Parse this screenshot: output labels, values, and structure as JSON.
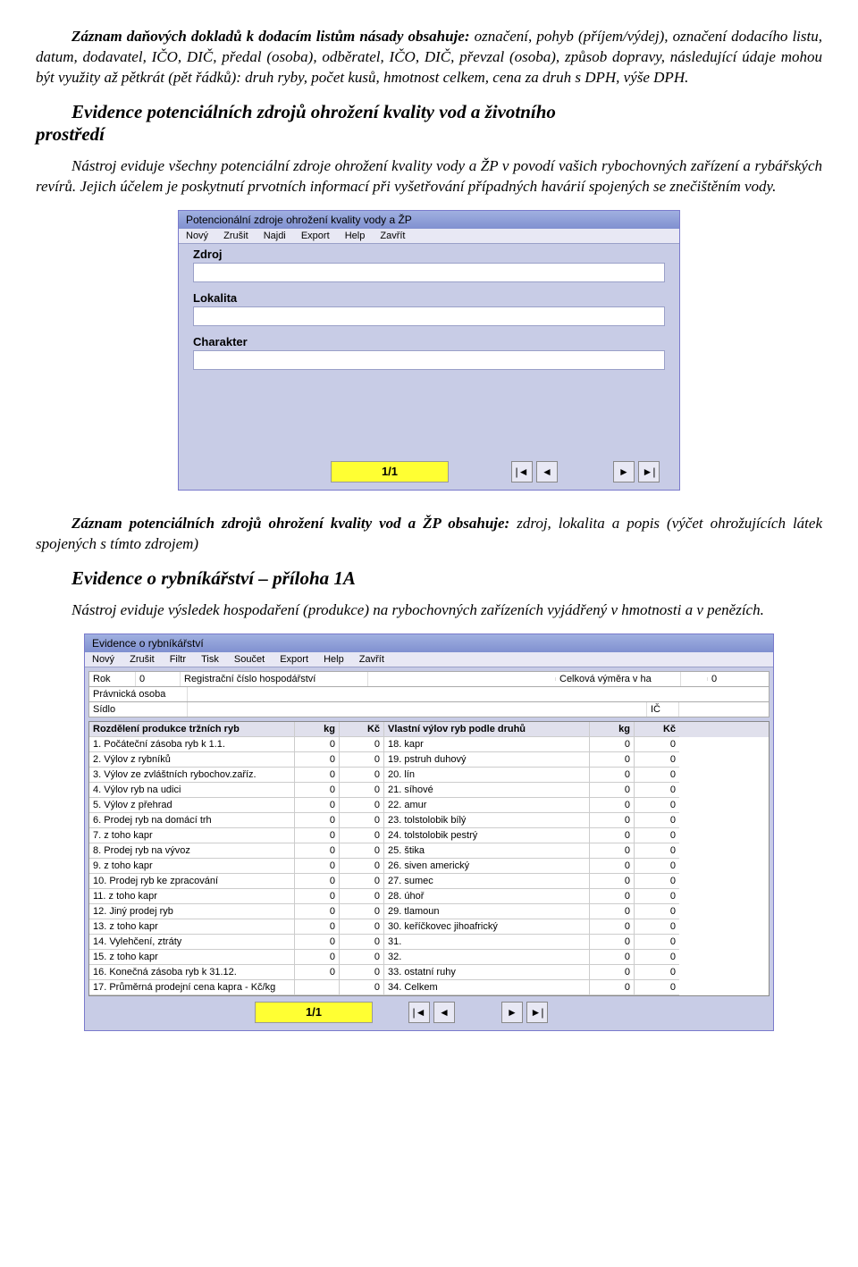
{
  "para1_lead": "Záznam daňových dokladů k dodacím listům násady obsahuje:",
  "para1_rest": " označení, pohyb (příjem/výdej), označení dodacího listu, datum, dodavatel, IČO, DIČ, předal (osoba), odběratel, IČO, DIČ, převzal (osoba), způsob dopravy, následující údaje mohou být využity až pětkrát (pět řádků): druh ryby, počet kusů, hmotnost celkem, cena za druh s DPH, výše DPH.",
  "heading1_head": "Evidence potenciálních zdrojů ohrožení kvality vod a životního",
  "heading1_tail": "prostředí",
  "para2": "Nástroj eviduje všechny potenciální zdroje ohrožení kvality vody a ŽP v povodí vašich rybochovných zařízení a rybářských revírů. Jejich účelem je poskytnutí prvotních informací při vyšetřování případných havárií spojených se znečištěním vody.",
  "win1": {
    "title": "Potencionální zdroje ohrožení kvality vody a ŽP",
    "menu": [
      "Nový",
      "Zrušit",
      "Najdi",
      "Export",
      "Help",
      "Zavřít"
    ],
    "labels": {
      "zdroj": "Zdroj",
      "lokalita": "Lokalita",
      "charakter": "Charakter"
    },
    "pager": "1/1"
  },
  "para3_lead": "Záznam potenciálních zdrojů ohrožení kvality vod a ŽP obsahuje:",
  "para3_rest": " zdroj, lokalita a popis (výčet ohrožujících látek spojených s tímto zdrojem)",
  "heading2": "Evidence o rybníkářství – příloha 1A",
  "para4": "Nástroj eviduje výsledek hospodaření (produkce) na rybochovných zařízeních vyjádřený v hmotnosti a v penězích.",
  "win2": {
    "title": "Evidence o rybníkářství",
    "menu": [
      "Nový",
      "Zrušit",
      "Filtr",
      "Tisk",
      "Součet",
      "Export",
      "Help",
      "Zavřít"
    ],
    "top": {
      "rok_lbl": "Rok",
      "rok_val": "0",
      "reg_lbl": "Registrační číslo hospodářství",
      "vymera_lbl": "Celková výměra v ha",
      "vymera_val": "0",
      "prav_lbl": "Právnická osoba",
      "sidlo_lbl": "Sídlo",
      "ic_lbl": "IČ"
    },
    "head": {
      "left": "Rozdělení produkce tržních ryb",
      "kg": "kg",
      "kc": "Kč",
      "right": "Vlastní výlov ryb podle druhů",
      "kg2": "kg",
      "kc2": "Kč"
    },
    "rows": [
      {
        "l": "1. Počáteční zásoba ryb k 1.1.",
        "lkg": "0",
        "lkc": "0",
        "r": "18. kapr",
        "rkg": "0",
        "rkc": "0"
      },
      {
        "l": "2. Výlov z rybníků",
        "lkg": "0",
        "lkc": "0",
        "r": "19. pstruh duhový",
        "rkg": "0",
        "rkc": "0"
      },
      {
        "l": "3. Výlov ze zvláštních rybochov.zaříz.",
        "lkg": "0",
        "lkc": "0",
        "r": "20. lín",
        "rkg": "0",
        "rkc": "0"
      },
      {
        "l": "4. Výlov ryb na udici",
        "lkg": "0",
        "lkc": "0",
        "r": "21. síhové",
        "rkg": "0",
        "rkc": "0"
      },
      {
        "l": "5. Výlov z přehrad",
        "lkg": "0",
        "lkc": "0",
        "r": "22. amur",
        "rkg": "0",
        "rkc": "0"
      },
      {
        "l": "6. Prodej ryb na domácí trh",
        "lkg": "0",
        "lkc": "0",
        "r": "23. tolstolobik bílý",
        "rkg": "0",
        "rkc": "0"
      },
      {
        "l": "7. z toho kapr",
        "lkg": "0",
        "lkc": "0",
        "r": "24. tolstolobik pestrý",
        "rkg": "0",
        "rkc": "0"
      },
      {
        "l": "8. Prodej ryb na vývoz",
        "lkg": "0",
        "lkc": "0",
        "r": "25. štika",
        "rkg": "0",
        "rkc": "0"
      },
      {
        "l": "9. z toho kapr",
        "lkg": "0",
        "lkc": "0",
        "r": "26. siven americký",
        "rkg": "0",
        "rkc": "0"
      },
      {
        "l": "10. Prodej ryb ke zpracování",
        "lkg": "0",
        "lkc": "0",
        "r": "27. sumec",
        "rkg": "0",
        "rkc": "0"
      },
      {
        "l": "11. z toho kapr",
        "lkg": "0",
        "lkc": "0",
        "r": "28. úhoř",
        "rkg": "0",
        "rkc": "0"
      },
      {
        "l": "12. Jiný prodej ryb",
        "lkg": "0",
        "lkc": "0",
        "r": "29. tlamoun",
        "rkg": "0",
        "rkc": "0"
      },
      {
        "l": "13. z toho kapr",
        "lkg": "0",
        "lkc": "0",
        "r": "30. keříčkovec jihoafrický",
        "rkg": "0",
        "rkc": "0"
      },
      {
        "l": "14. Vylehčení, ztráty",
        "lkg": "0",
        "lkc": "0",
        "r": "31.",
        "rkg": "0",
        "rkc": "0"
      },
      {
        "l": "15. z toho kapr",
        "lkg": "0",
        "lkc": "0",
        "r": "32.",
        "rkg": "0",
        "rkc": "0"
      },
      {
        "l": "16. Konečná zásoba ryb k 31.12.",
        "lkg": "0",
        "lkc": "0",
        "r": "33. ostatní ruhy",
        "rkg": "0",
        "rkc": "0"
      },
      {
        "l": "17. Průměrná prodejní cena kapra - Kč/kg",
        "lkg": "",
        "lkc": "0",
        "r": "34. Celkem",
        "rkg": "0",
        "rkc": "0"
      }
    ],
    "pager": "1/1"
  }
}
